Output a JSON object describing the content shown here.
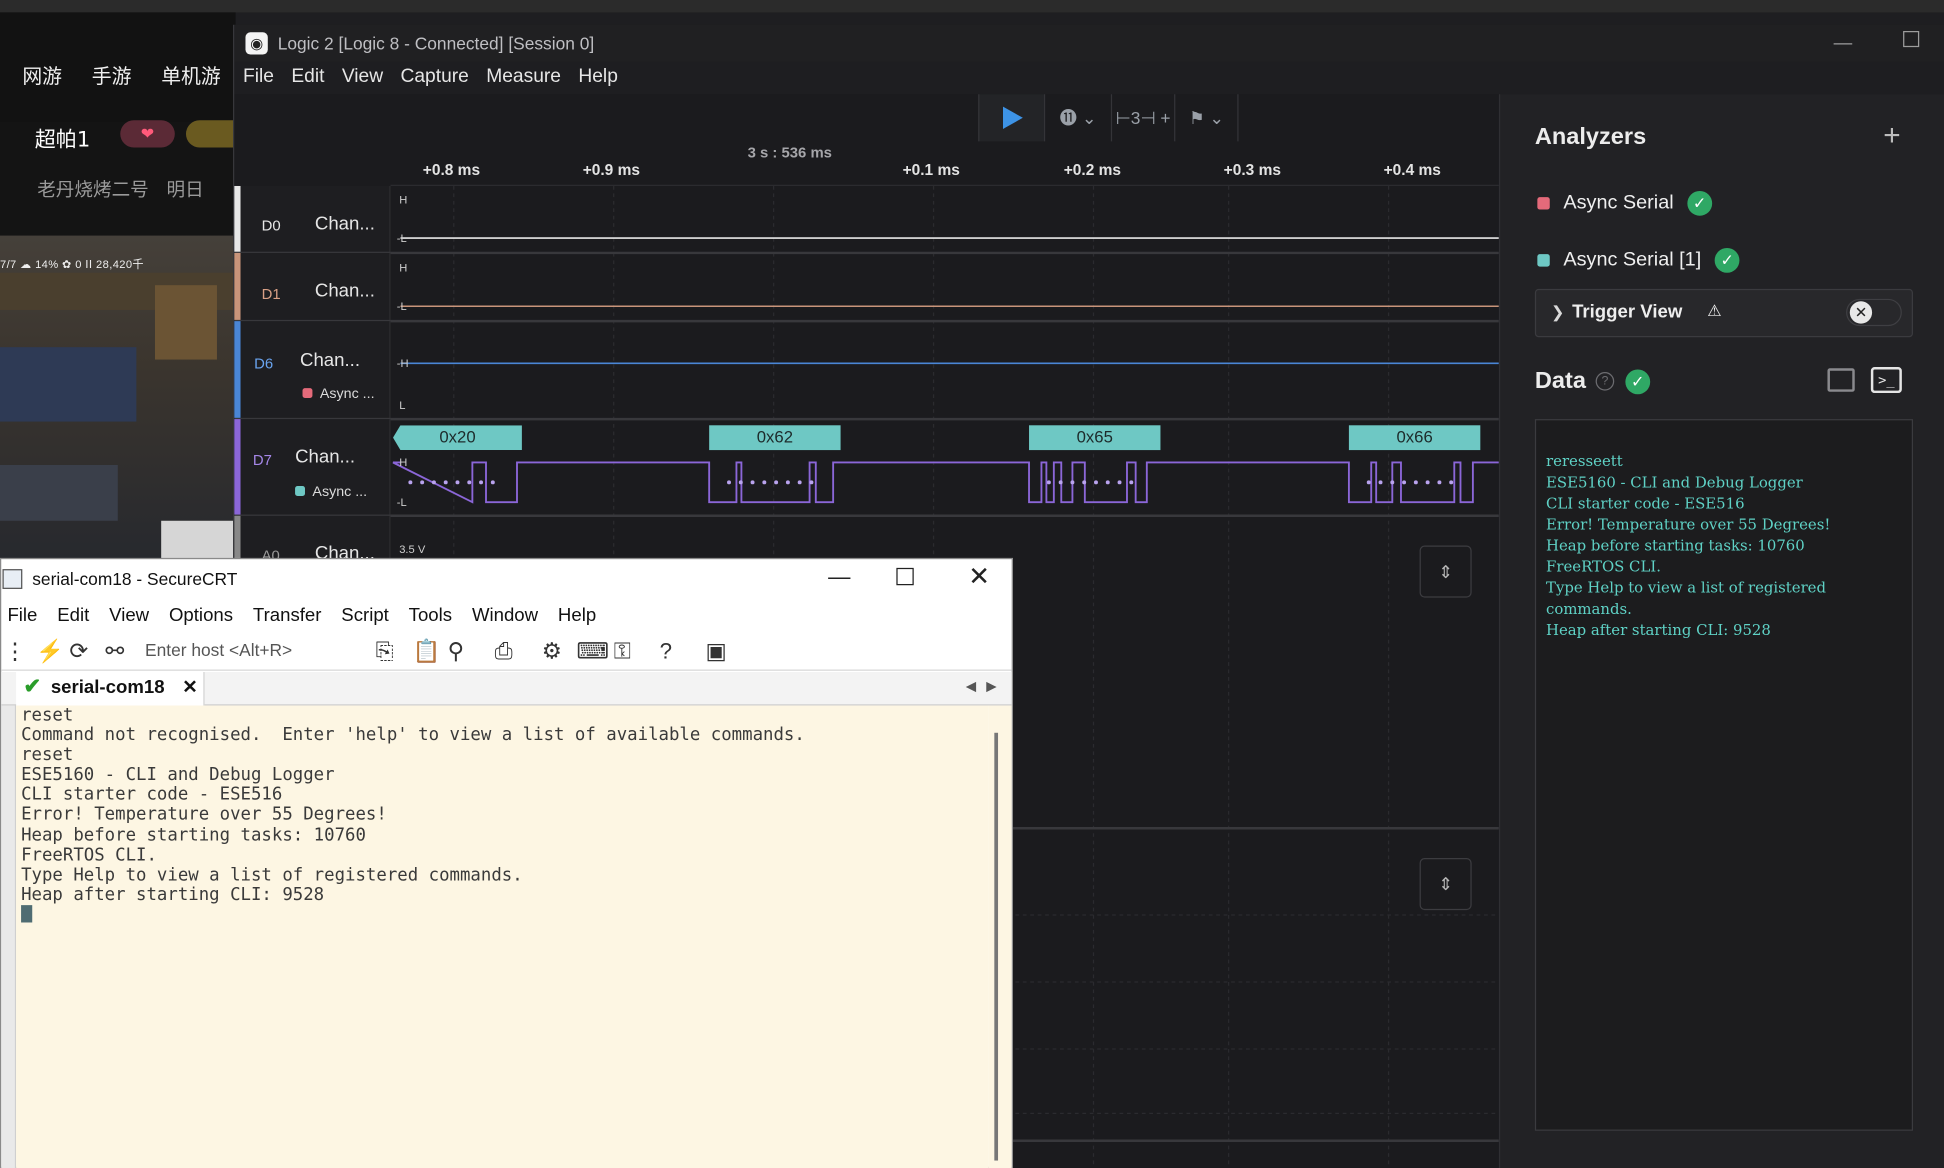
{
  "background_web": {
    "nav": [
      "网游",
      "手游",
      "单机游"
    ],
    "streamer_name": "超帕1",
    "subtitle": "老丹烧烤二号",
    "subtitle2": "明日",
    "game_stats": "7/7  ☁ 14%       ✿ 0  ⅠⅠ 28,420千"
  },
  "logic": {
    "title": "Logic 2 [Logic 8 - Connected] [Session 0]",
    "menu": [
      "File",
      "Edit",
      "View",
      "Capture",
      "Measure",
      "Help"
    ],
    "toolbar": {
      "marker_count": "3"
    },
    "ruler": {
      "center_label": "3 s : 536 ms",
      "ticks": [
        "+0.8 ms",
        "+0.9 ms",
        "+0.1 ms",
        "+0.2 ms",
        "+0.3 ms",
        "+0.4 ms"
      ]
    },
    "channels": [
      {
        "id": "D0",
        "name": "Chan...",
        "color": "#e8e8e8",
        "id_color": "#e8e8e8"
      },
      {
        "id": "D1",
        "name": "Chan...",
        "color": "#c8947a",
        "id_color": "#d9a086"
      },
      {
        "id": "D6",
        "name": "Chan...",
        "analyzer": "Async ...",
        "color": "#4a86d6",
        "id_color": "#6aa4f0",
        "analyzer_color": "#e46a7a"
      },
      {
        "id": "D7",
        "name": "Chan...",
        "analyzer": "Async ...",
        "color": "#8b66d8",
        "id_color": "#a587e8",
        "analyzer_color": "#6ec8c4"
      },
      {
        "id": "A0",
        "name": "Chan...",
        "color": "#888888",
        "id_color": "#9a9a9a"
      }
    ],
    "level_labels": {
      "high": "H",
      "low": "L",
      "analog_top": "3.5 V"
    },
    "frames": [
      "0x20",
      "0x62",
      "0x65",
      "0x66"
    ],
    "extend_icon": "⇕"
  },
  "analyzers_panel": {
    "title": "Analyzers",
    "add_icon": "+",
    "items": [
      {
        "name": "Async Serial",
        "color": "#e46a7a"
      },
      {
        "name": "Async Serial [1]",
        "color": "#6ec8c4"
      }
    ],
    "trigger_view": {
      "label": "Trigger View",
      "warning": "⚠"
    },
    "data_title": "Data",
    "help_icon": "?",
    "terminal_lines": [
      "reresseett",
      "ESE5160 - CLI and Debug Logger",
      "CLI starter code - ESE516",
      "Error! Temperature over 55 Degrees!",
      "Heap before starting tasks: 10760",
      "FreeRTOS CLI.",
      "Type Help to view a list of registered commands.",
      "Heap after starting CLI: 9528"
    ]
  },
  "securecrt": {
    "title": "serial-com18 - SecureCRT",
    "menu": [
      "File",
      "Edit",
      "View",
      "Options",
      "Transfer",
      "Script",
      "Tools",
      "Window",
      "Help"
    ],
    "host_placeholder": "Enter host <Alt+R>",
    "tab_label": "serial-com18",
    "terminal_lines": [
      "reset",
      "Command not recognised.  Enter 'help' to view a list of available commands.",
      "",
      "reset",
      "ESE5160 - CLI and Debug Logger",
      "CLI starter code - ESE516",
      "Error! Temperature over 55 Degrees!",
      "Heap before starting tasks: 10760",
      "FreeRTOS CLI.",
      "Type Help to view a list of registered commands.",
      "Heap after starting CLI: 9528"
    ]
  }
}
